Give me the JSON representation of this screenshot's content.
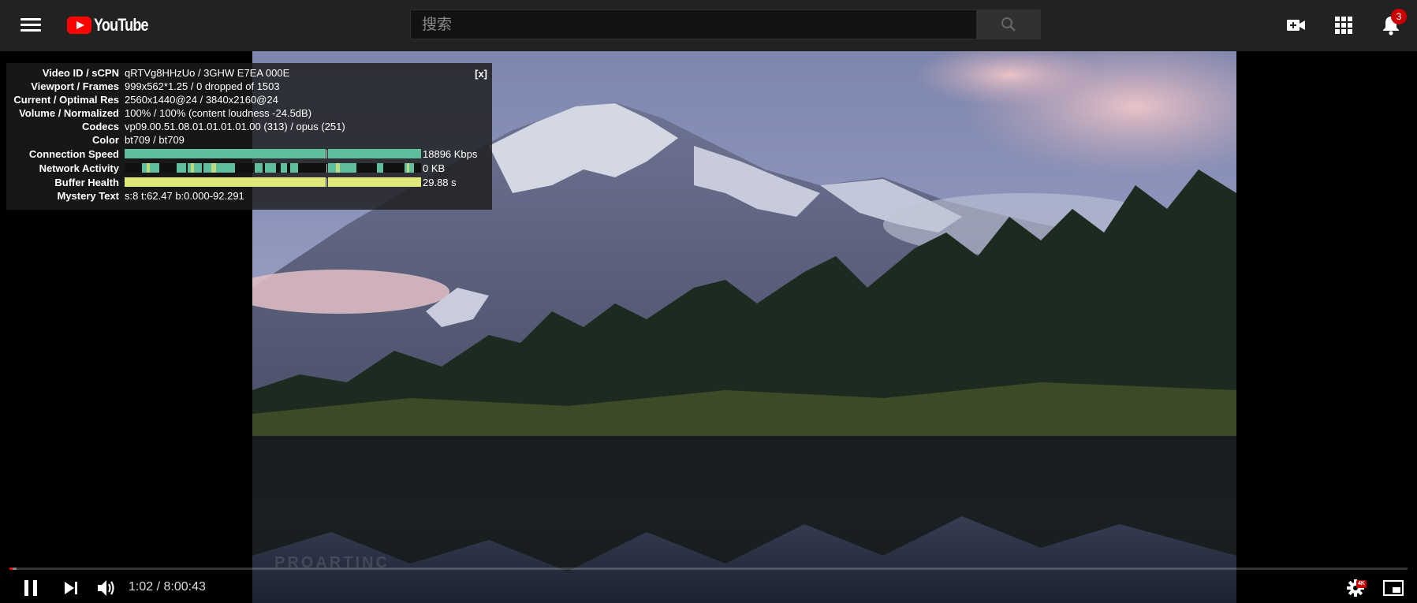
{
  "header": {
    "logo_text": "YouTube",
    "search_placeholder": "搜索",
    "notification_count": "3"
  },
  "colors": {
    "brand_red": "#ff0000",
    "topbar_bg": "#222222",
    "connection_bar": "#6cc6a2",
    "buffer_bar": "#e8f07a",
    "progress_played": "#ff0000"
  },
  "icons": {
    "menu": "hamburger-menu-icon",
    "search": "search-icon",
    "create": "video-camera-plus-icon",
    "apps": "apps-grid-icon",
    "notifications": "bell-icon",
    "play_pause": "pause-icon",
    "next": "next-track-icon",
    "volume": "volume-icon",
    "settings": "gear-icon",
    "miniplayer": "miniplayer-icon"
  },
  "stats": {
    "close_label": "[x]",
    "rows": [
      {
        "label": "Video ID / sCPN",
        "value": "qRTVg8HHzUo / 3GHW E7EA 000E"
      },
      {
        "label": "Viewport / Frames",
        "value": "999x562*1.25 / 0 dropped of 1503"
      },
      {
        "label": "Current / Optimal Res",
        "value": "2560x1440@24 / 3840x2160@24"
      },
      {
        "label": "Volume / Normalized",
        "value": "100% / 100% (content loudness -24.5dB)"
      },
      {
        "label": "Codecs",
        "value": "vp09.00.51.08.01.01.01.01.00 (313) / opus (251)"
      },
      {
        "label": "Color",
        "value": "bt709 / bt709"
      }
    ],
    "connection_speed": {
      "label": "Connection Speed",
      "value": "18896 Kbps"
    },
    "network_activity": {
      "label": "Network Activity",
      "value": "0 KB"
    },
    "buffer_health": {
      "label": "Buffer Health",
      "value": "29.88 s"
    },
    "mystery_text": {
      "label": "Mystery Text",
      "value": "s:8 t:62.47 b:0.000-92.291"
    }
  },
  "player": {
    "time_display": "1:02 / 8:00:43",
    "progress_played_fraction": 0.0021,
    "progress_loaded_fraction": 0.0048,
    "quality_badge": "4K",
    "watermark": "PROARTINC"
  }
}
